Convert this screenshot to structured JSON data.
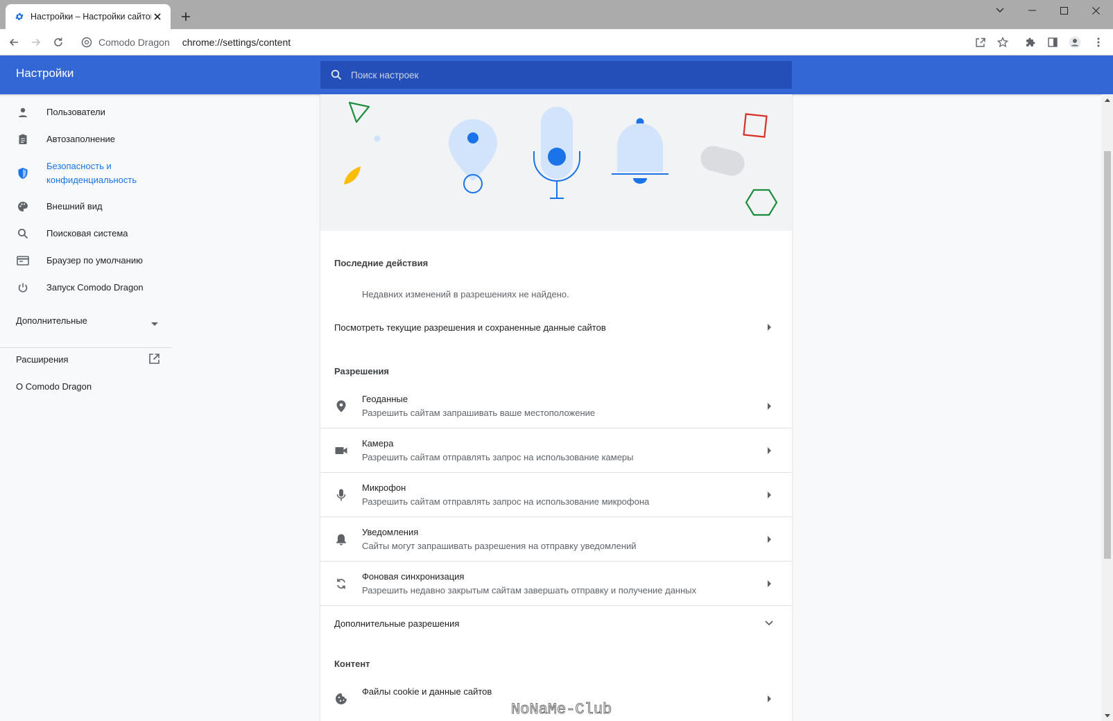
{
  "browser": {
    "tab_title": "Настройки – Настройки сайтов",
    "site_name": "Comodo Dragon",
    "url": "chrome://settings/content"
  },
  "header": {
    "title": "Настройки",
    "search_placeholder": "Поиск настроек"
  },
  "sidebar": {
    "items": [
      {
        "label": "Пользователи",
        "icon": "person-icon"
      },
      {
        "label": "Автозаполнение",
        "icon": "clipboard-icon"
      },
      {
        "label": "Безопасность и конфиденциальность",
        "icon": "shield-icon",
        "active": true
      },
      {
        "label": "Внешний вид",
        "icon": "palette-icon"
      },
      {
        "label": "Поисковая система",
        "icon": "search-icon"
      },
      {
        "label": "Браузер по умолчанию",
        "icon": "browser-icon"
      },
      {
        "label": "Запуск Comodo Dragon",
        "icon": "power-icon"
      }
    ],
    "advanced_label": "Дополнительные",
    "extensions_label": "Расширения",
    "about_label": "О Comodo Dragon"
  },
  "main": {
    "recent_title": "Последние действия",
    "recent_empty": "Недавних изменений в разрешениях не найдено.",
    "view_permissions_label": "Посмотреть текущие разрешения и сохраненные данные сайтов",
    "permissions_title": "Разрешения",
    "permissions": [
      {
        "title": "Геоданные",
        "subtitle": "Разрешить сайтам запрашивать ваше местоположение",
        "icon": "location-pin-icon"
      },
      {
        "title": "Камера",
        "subtitle": "Разрешить сайтам отправлять запрос на использование камеры",
        "icon": "camera-icon"
      },
      {
        "title": "Микрофон",
        "subtitle": "Разрешить сайтам отправлять запрос на использование микрофона",
        "icon": "microphone-icon"
      },
      {
        "title": "Уведомления",
        "subtitle": "Сайты могут запрашивать разрешения на отправку уведомлений",
        "icon": "bell-icon"
      },
      {
        "title": "Фоновая синхронизация",
        "subtitle": "Разрешить недавно закрытым сайтам завершать отправку и получение данных",
        "icon": "sync-icon"
      }
    ],
    "additional_permissions_label": "Дополнительные разрешения",
    "content_title": "Контент",
    "cookies_label": "Файлы cookie и данные сайтов"
  },
  "watermark": "NoNaMe-Club",
  "colors": {
    "header_blue": "#3367d6",
    "search_bg": "#254fb8",
    "active_link": "#1a73e8"
  }
}
